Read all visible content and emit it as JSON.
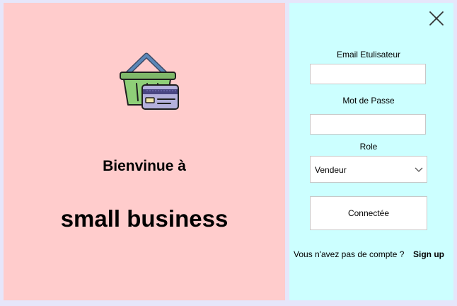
{
  "welcome": {
    "greeting": "Bienvinue à",
    "business_name": "small business"
  },
  "icons": {
    "logo": "basket-with-credit-card-icon",
    "close": "close-icon",
    "chevron": "chevron-down-icon"
  },
  "login": {
    "email_label": "Email Etulisateur",
    "email_value": "",
    "password_label": "Mot de Passe",
    "password_value": "",
    "role_label": "Role",
    "role_selected": "Vendeur",
    "connect_label": "Connectée",
    "no_account_text": "Vous n'avez pas de compte ?",
    "signup_label": "Sign up"
  },
  "colors": {
    "background": "#e6e6fa",
    "left_panel": "#ffcccc",
    "right_panel": "#ccffff"
  }
}
